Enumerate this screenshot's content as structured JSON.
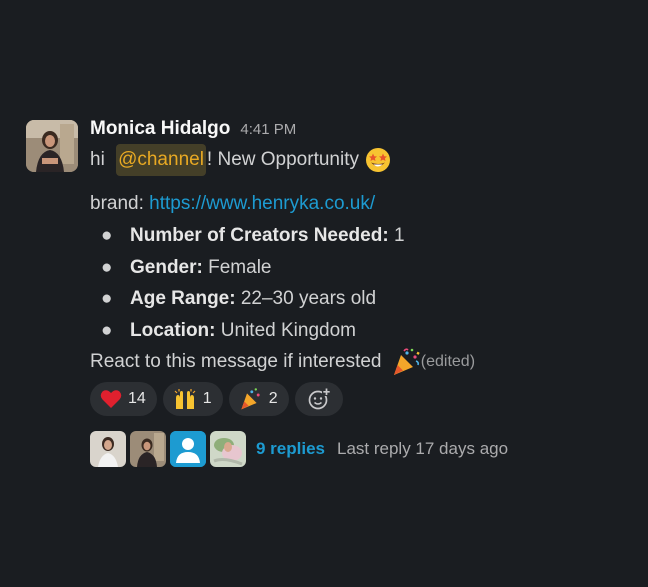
{
  "message": {
    "sender": "Monica Hidalgo",
    "timestamp": "4:41 PM",
    "greeting_prefix": "hi ",
    "mention": "@channel",
    "greeting_suffix": "! New Opportunity",
    "greeting_emoji": "star-struck",
    "brand_label": "brand: ",
    "brand_link": "https://www.henryka.co.uk/",
    "details": [
      {
        "label": "Number of Creators Needed:",
        "value": " 1"
      },
      {
        "label": "Gender:",
        "value": " Female"
      },
      {
        "label": "Age Range:",
        "value": " 22–30 years old"
      },
      {
        "label": "Location:",
        "value": " United Kingdom"
      }
    ],
    "closing_text": "React to this message if interested ",
    "closing_emoji": "party-popper",
    "edited_label": "(edited)"
  },
  "reactions": [
    {
      "emoji": "red-heart",
      "count": "14"
    },
    {
      "emoji": "raising-hands",
      "count": "1"
    },
    {
      "emoji": "party-popper",
      "count": "2"
    }
  ],
  "add_reaction_icon": "add-reaction-icon",
  "thread": {
    "replies_label": "9 replies",
    "last_reply": "Last reply 17 days ago"
  },
  "colors": {
    "background": "#1a1d21",
    "link": "#1d9bd1",
    "mention_text": "#e8a923",
    "reaction_pill": "#2c2f33"
  }
}
